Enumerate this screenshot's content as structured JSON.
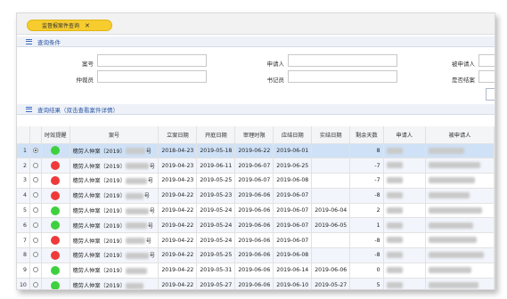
{
  "tab": {
    "label": "监督报案件查询",
    "close": "✕"
  },
  "query": {
    "header": "查询条件",
    "fields": [
      {
        "label": "案号",
        "value": "",
        "placeholder": ""
      },
      {
        "label": "申请人",
        "value": "",
        "placeholder": ""
      },
      {
        "label": "被申请人",
        "value": "",
        "placeholder": ""
      },
      {
        "label": "仲裁员",
        "value": "",
        "placeholder": ""
      },
      {
        "label": "书记员",
        "value": "",
        "placeholder": ""
      },
      {
        "label": "是否结案",
        "value": "",
        "placeholder": ""
      }
    ]
  },
  "results": {
    "header": "查询结果（双击查看案件详情）",
    "columns": [
      "时效提醒",
      "案号",
      "立案日期",
      "开庭日期",
      "审理时限",
      "应结日期",
      "实结日期",
      "剩余天数",
      "申请人",
      "被申请人"
    ],
    "rows": [
      {
        "num": "1",
        "selected": true,
        "status": "green",
        "case_prefix": "穗劳人仲案〔2019〕",
        "case_suffix": "号",
        "filed": "2018-04-23",
        "hearing": "2019-05-18",
        "limit": "2019-06-22",
        "due": "2019-06-01",
        "closed": "",
        "remain": "8"
      },
      {
        "num": "2",
        "selected": false,
        "status": "red",
        "case_prefix": "穗劳人仲案〔2019〕",
        "case_suffix": "号",
        "filed": "2019-04-23",
        "hearing": "2019-06-11",
        "limit": "2019-06-07",
        "due": "2019-06-25",
        "closed": "",
        "remain": "-7"
      },
      {
        "num": "3",
        "selected": false,
        "status": "red",
        "case_prefix": "穗劳人仲案〔2019〕",
        "case_suffix": "号",
        "filed": "2019-04-23",
        "hearing": "2019-05-25",
        "limit": "2019-06-07",
        "due": "2019-06-08",
        "closed": "",
        "remain": "-7"
      },
      {
        "num": "4",
        "selected": false,
        "status": "red",
        "case_prefix": "穗劳人仲案〔2019〕",
        "case_suffix": "号",
        "filed": "2019-04-22",
        "hearing": "2019-05-23",
        "limit": "2019-06-06",
        "due": "2019-06-07",
        "closed": "",
        "remain": "-8"
      },
      {
        "num": "5",
        "selected": false,
        "status": "green",
        "case_prefix": "穗劳人仲案〔2019〕",
        "case_suffix": "号",
        "filed": "2019-04-22",
        "hearing": "2019-05-24",
        "limit": "2019-06-06",
        "due": "2019-06-07",
        "closed": "2019-06-04",
        "remain": "2"
      },
      {
        "num": "6",
        "selected": false,
        "status": "green",
        "case_prefix": "穗劳人仲案〔2019〕",
        "case_suffix": "号",
        "filed": "2019-04-22",
        "hearing": "2019-05-24",
        "limit": "2019-06-06",
        "due": "2019-06-07",
        "closed": "2019-06-05",
        "remain": "1"
      },
      {
        "num": "7",
        "selected": false,
        "status": "red",
        "case_prefix": "穗劳人仲案〔2019〕",
        "case_suffix": "号",
        "filed": "2019-04-22",
        "hearing": "2019-05-24",
        "limit": "2019-06-06",
        "due": "2019-06-07",
        "closed": "",
        "remain": "-8"
      },
      {
        "num": "8",
        "selected": false,
        "status": "red",
        "case_prefix": "穗劳人仲案〔2019〕",
        "case_suffix": "号",
        "filed": "2019-04-22",
        "hearing": "2019-05-25",
        "limit": "2019-06-06",
        "due": "2019-06-08",
        "closed": "",
        "remain": "-8"
      },
      {
        "num": "9",
        "selected": false,
        "status": "green",
        "case_prefix": "穗劳人仲案〔2019〕",
        "case_suffix": "",
        "filed": "2019-04-22",
        "hearing": "2019-05-31",
        "limit": "2019-06-06",
        "due": "2019-06-14",
        "closed": "2019-06-06",
        "remain": "0"
      },
      {
        "num": "10",
        "selected": false,
        "status": "green",
        "case_prefix": "穗劳人仲案〔2019〕",
        "case_suffix": "",
        "filed": "2019-04-22",
        "hearing": "2019-05-27",
        "limit": "2019-06-06",
        "due": "2019-06-10",
        "closed": "2019-05-27",
        "remain": "5"
      }
    ]
  },
  "colors": {
    "green": "#3ed13e",
    "red": "#ee3a3a",
    "accent": "#2a55a5",
    "tab": "#f6cc2e"
  }
}
